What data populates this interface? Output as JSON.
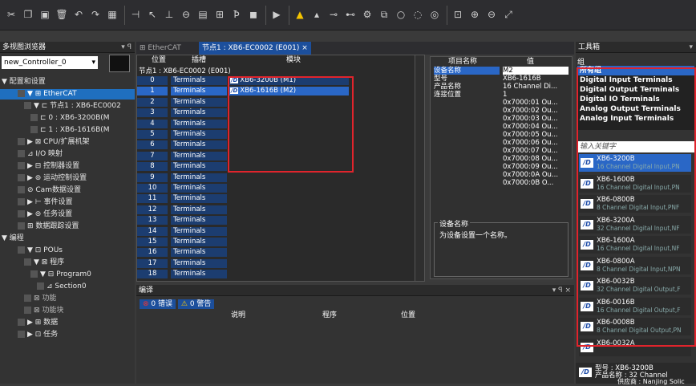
{
  "toolbar": {
    "buttons": [
      "cut-icon",
      "copy-icon",
      "paste-icon",
      "delete-icon",
      "undo-icon",
      "redo-icon",
      "grid-icon",
      "sep",
      "ladder-icon",
      "cursor-icon",
      "contact-icon",
      "coil-icon",
      "block-icon",
      "network-icon",
      "find-icon",
      "stop-icon",
      "sep",
      "run-icon",
      "sep",
      "warn-icon",
      "warn2-icon",
      "link-icon",
      "link2-icon",
      "settings-icon",
      "copy2-icon",
      "cycle-icon",
      "cycle2-icon",
      "cycle3-icon",
      "sep",
      "frame-icon",
      "zoom-in-icon",
      "zoom-out-icon",
      "fit-icon"
    ]
  },
  "left": {
    "title": "多视图浏览器",
    "controller": "new_Controller_0",
    "tree": [
      {
        "label": "▼ 配置和设置",
        "lvl": 0,
        "cls": ""
      },
      {
        "label": "▼ ⊞ EtherCAT",
        "lvl": 1,
        "cls": "sel"
      },
      {
        "label": "▼ ⊏ 节点1 : XB6-EC0002",
        "lvl": 2,
        "cls": ""
      },
      {
        "label": "⊏ 0 : XB6-3200B(M",
        "lvl": 3,
        "cls": ""
      },
      {
        "label": "⊏ 1 : XB6-1616B(M",
        "lvl": 3,
        "cls": ""
      },
      {
        "label": "▶ ⊠ CPU/扩展机架",
        "lvl": 1,
        "cls": ""
      },
      {
        "label": "⊿ I/O 映射",
        "lvl": 1,
        "cls": ""
      },
      {
        "label": "▶ ⊟ 控制器设置",
        "lvl": 1,
        "cls": ""
      },
      {
        "label": "▶ ⊚ 运动控制设置",
        "lvl": 1,
        "cls": ""
      },
      {
        "label": "⊘ Cam数据设置",
        "lvl": 1,
        "cls": ""
      },
      {
        "label": "▶ ⊢ 事件设置",
        "lvl": 1,
        "cls": ""
      },
      {
        "label": "▶ ⊜ 任务设置",
        "lvl": 1,
        "cls": ""
      },
      {
        "label": "⊞ 数据跟踪设置",
        "lvl": 1,
        "cls": ""
      },
      {
        "label": "▼ 编程",
        "lvl": 0,
        "cls": ""
      },
      {
        "label": "▼ ⊡ POUs",
        "lvl": 1,
        "cls": ""
      },
      {
        "label": "▼ ⊠ 程序",
        "lvl": 2,
        "cls": ""
      },
      {
        "label": "▼ ⊟ Program0",
        "lvl": 3,
        "cls": ""
      },
      {
        "label": "⊿ Section0",
        "lvl": 4,
        "cls": ""
      },
      {
        "label": "⊠ 功能",
        "lvl": 2,
        "cls": "dim"
      },
      {
        "label": "⊠ 功能块",
        "lvl": 2,
        "cls": "dim"
      },
      {
        "label": "▶ ⊞ 数据",
        "lvl": 1,
        "cls": ""
      },
      {
        "label": "▶ ⊡ 任务",
        "lvl": 1,
        "cls": ""
      }
    ]
  },
  "center": {
    "tab1": "EtherCAT",
    "tab2": "节点1 : XB6-EC0002 (E001)",
    "tab2_close": "×",
    "col_pos": "位置",
    "col_slot": "插槽",
    "col_mod": "模块",
    "node_line": "节点1 : XB6-EC0002 (E001)",
    "rows": [
      {
        "p": "0",
        "s": "Terminals",
        "m": "XB6-3200B (M1)",
        "cls": "rowbg"
      },
      {
        "p": "1",
        "s": "Terminals",
        "m": "XB6-1616B (M2)",
        "cls": "rowsel"
      },
      {
        "p": "2",
        "s": "Terminals",
        "m": "",
        "cls": "rowbg"
      },
      {
        "p": "3",
        "s": "Terminals",
        "m": "",
        "cls": "rowbg"
      },
      {
        "p": "4",
        "s": "Terminals",
        "m": "",
        "cls": "rowbg"
      },
      {
        "p": "5",
        "s": "Terminals",
        "m": "",
        "cls": "rowbg"
      },
      {
        "p": "6",
        "s": "Terminals",
        "m": "",
        "cls": "rowbg"
      },
      {
        "p": "7",
        "s": "Terminals",
        "m": "",
        "cls": "rowbg"
      },
      {
        "p": "8",
        "s": "Terminals",
        "m": "",
        "cls": "rowbg"
      },
      {
        "p": "9",
        "s": "Terminals",
        "m": "",
        "cls": "rowbg"
      },
      {
        "p": "10",
        "s": "Terminals",
        "m": "",
        "cls": "rowbg"
      },
      {
        "p": "11",
        "s": "Terminals",
        "m": "",
        "cls": "rowbg"
      },
      {
        "p": "12",
        "s": "Terminals",
        "m": "",
        "cls": "rowbg"
      },
      {
        "p": "13",
        "s": "Terminals",
        "m": "",
        "cls": "rowbg"
      },
      {
        "p": "14",
        "s": "Terminals",
        "m": "",
        "cls": "rowbg"
      },
      {
        "p": "15",
        "s": "Terminals",
        "m": "",
        "cls": "rowbg"
      },
      {
        "p": "16",
        "s": "Terminals",
        "m": "",
        "cls": "rowbg"
      },
      {
        "p": "17",
        "s": "Terminals",
        "m": "",
        "cls": "rowbg"
      },
      {
        "p": "18",
        "s": "Terminals",
        "m": "",
        "cls": "rowbg"
      }
    ]
  },
  "props": {
    "h_name": "项目名称",
    "h_val": "值",
    "rows": [
      {
        "k": "设备名称",
        "v": "M2"
      },
      {
        "k": "型号",
        "v": "XB6-1616B"
      },
      {
        "k": "产品名称",
        "v": "16 Channel Di..."
      },
      {
        "k": "连接位置",
        "v": "1"
      },
      {
        "k": "",
        "v": "0x7000:01 Ou..."
      },
      {
        "k": "",
        "v": "0x7000:02 Ou..."
      },
      {
        "k": "",
        "v": "0x7000:03 Ou..."
      },
      {
        "k": "",
        "v": "0x7000:04 Ou..."
      },
      {
        "k": "",
        "v": "0x7000:05 Ou..."
      },
      {
        "k": "",
        "v": "0x7000:06 Ou..."
      },
      {
        "k": "",
        "v": "0x7000:07 Ou..."
      },
      {
        "k": "",
        "v": "0x7000:08 Ou..."
      },
      {
        "k": "",
        "v": "0x7000:09 Ou..."
      },
      {
        "k": "",
        "v": "0x7000:0A Ou..."
      },
      {
        "k": "",
        "v": "0x7000:0B O..."
      }
    ],
    "desc_title": "设备名称",
    "desc_text": "为设备设置一个名称。"
  },
  "compile": {
    "title": "编译",
    "err": "0 错误",
    "warn": "0 警告",
    "col_desc": "说明",
    "col_prog": "程序",
    "col_pos": "位置"
  },
  "right": {
    "title": "工具箱",
    "group_label": "组",
    "groups": [
      "所有组",
      "Digital Input Terminals",
      "Digital Output Terminals",
      "Digital IO Terminals",
      "Analog Output Terminals",
      "Analog Input Terminals"
    ],
    "search_placeholder": "输入关键字",
    "items": [
      {
        "n": "XB6-3200B",
        "d": "16 Channel Digital Input,PN"
      },
      {
        "n": "XB6-1600B",
        "d": "16 Channel Digital Input,PN"
      },
      {
        "n": "XB6-0800B",
        "d": "8 Channel Digital Input,PNF"
      },
      {
        "n": "XB6-3200A",
        "d": "32 Channel Digital Input,NF"
      },
      {
        "n": "XB6-1600A",
        "d": "16 Channel Digital Input,NF"
      },
      {
        "n": "XB6-0800A",
        "d": "8 Channel Digital Input,NPN"
      },
      {
        "n": "XB6-0032B",
        "d": "32 Channel Digital Output,F"
      },
      {
        "n": "XB6-0016B",
        "d": "16 Channel Digital Output,F"
      },
      {
        "n": "XB6-0008B",
        "d": "8 Channel Digital Output,PN"
      },
      {
        "n": "XB6-0032A",
        "d": ""
      }
    ],
    "info_model": "型号 : XB6-3200B",
    "info_product": "产品名称 : 32 Channel",
    "info_vendor": "供应商 : Nanjing Solic"
  },
  "colors": {
    "highlight": "#e0242c",
    "selection": "#2a67c6"
  }
}
